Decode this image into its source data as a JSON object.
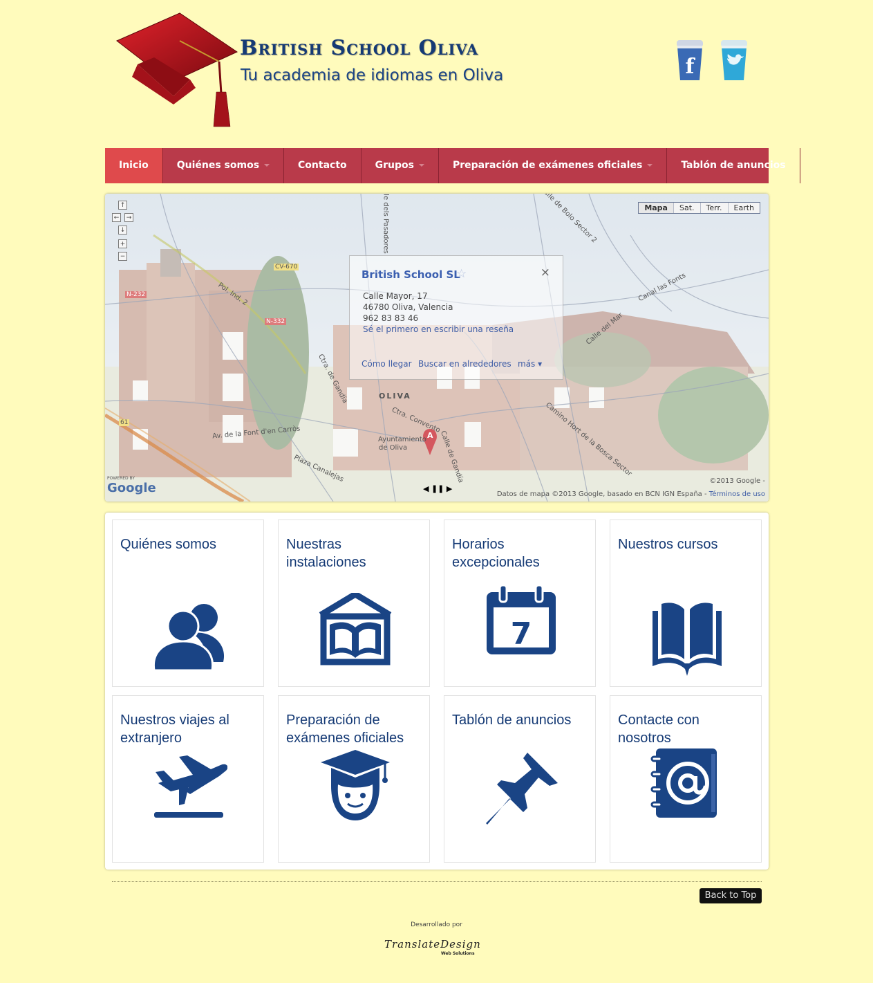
{
  "header": {
    "title": "British School Oliva",
    "tagline": "Tu academia de idiomas en Oliva",
    "social": [
      {
        "name": "facebook",
        "letter": "f",
        "color": "#3a6ab5"
      },
      {
        "name": "twitter",
        "letter": "t",
        "color": "#2fa8d8"
      }
    ]
  },
  "nav": {
    "items": [
      {
        "label": "Inicio"
      },
      {
        "label": "Quiénes somos"
      },
      {
        "label": "Contacto"
      },
      {
        "label": "Grupos"
      },
      {
        "label": "Preparación de exámenes oficiales"
      },
      {
        "label": "Tablón de anuncios"
      }
    ]
  },
  "map": {
    "map_types": [
      "Mapa",
      "Sat.",
      "Terr.",
      "Earth"
    ],
    "selected_map_type": "Mapa",
    "info": {
      "title": "British School SL",
      "address1": "Calle Mayor, 17",
      "address2": "46780 Oliva, Valencia",
      "phone": "962 83 83 46",
      "review_link": "Sé el primero en escribir una reseña",
      "directions": "Cómo llegar",
      "nearby": "Buscar en alrededores",
      "more": "más"
    },
    "labels": {
      "town": "OLIVA",
      "city_hall_1": "Ayuntamiento",
      "city_hall_2": "de Oliva",
      "road1": "Pol. Ind. 2",
      "road2": "Ctra. de Gandía",
      "road3": "Ctra. Convento",
      "road4": "Camino Hort de la Bosca Sector",
      "road5": "Calle de Bolo Sector 2",
      "road6": "Canal las Fonts",
      "road7": "Av. de la Font d'en Carròs",
      "road8": "Plaza Canalejas",
      "road9": "Calle del Mar",
      "road10": "Calle de Gandía",
      "road11": "Calle dels Pasadores",
      "shield1": "CV-670",
      "shield2": "N-232",
      "shield3": "N-332",
      "shield4": "61",
      "marker": "A"
    },
    "copyright": "©2013 Google -",
    "data_credit": "Datos de mapa ©2013 Google, basado en BCN IGN España -",
    "terms": "Términos de uso",
    "powered_by": "POWERED BY",
    "google": "Google"
  },
  "cards": [
    {
      "title": "Quiénes somos",
      "icon": "users-icon"
    },
    {
      "title": "Nuestras instalaciones",
      "icon": "building-book-icon"
    },
    {
      "title": "Horarios excepcionales",
      "icon": "calendar-icon",
      "calendar_day": "7"
    },
    {
      "title": "Nuestros cursos",
      "icon": "open-book-icon"
    },
    {
      "title": "Nuestros viajes al extranjero",
      "icon": "airplane-departure-icon"
    },
    {
      "title": "Preparación de exámenes oficiales",
      "icon": "graduate-icon"
    },
    {
      "title": "Tablón de anuncios",
      "icon": "pushpin-icon"
    },
    {
      "title": "Contacte con nosotros",
      "icon": "address-book-icon"
    }
  ],
  "icon_color": "#1a4485",
  "nav_color": "#b93a4a",
  "nav_active_color": "#df4a4c",
  "background_color": "#fffbbc",
  "footer": {
    "back_to_top": "Back to Top",
    "developed_by": "Desarrollado por",
    "dev_logo": "TranslateDesign",
    "dev_sub": "Web Solutions"
  }
}
